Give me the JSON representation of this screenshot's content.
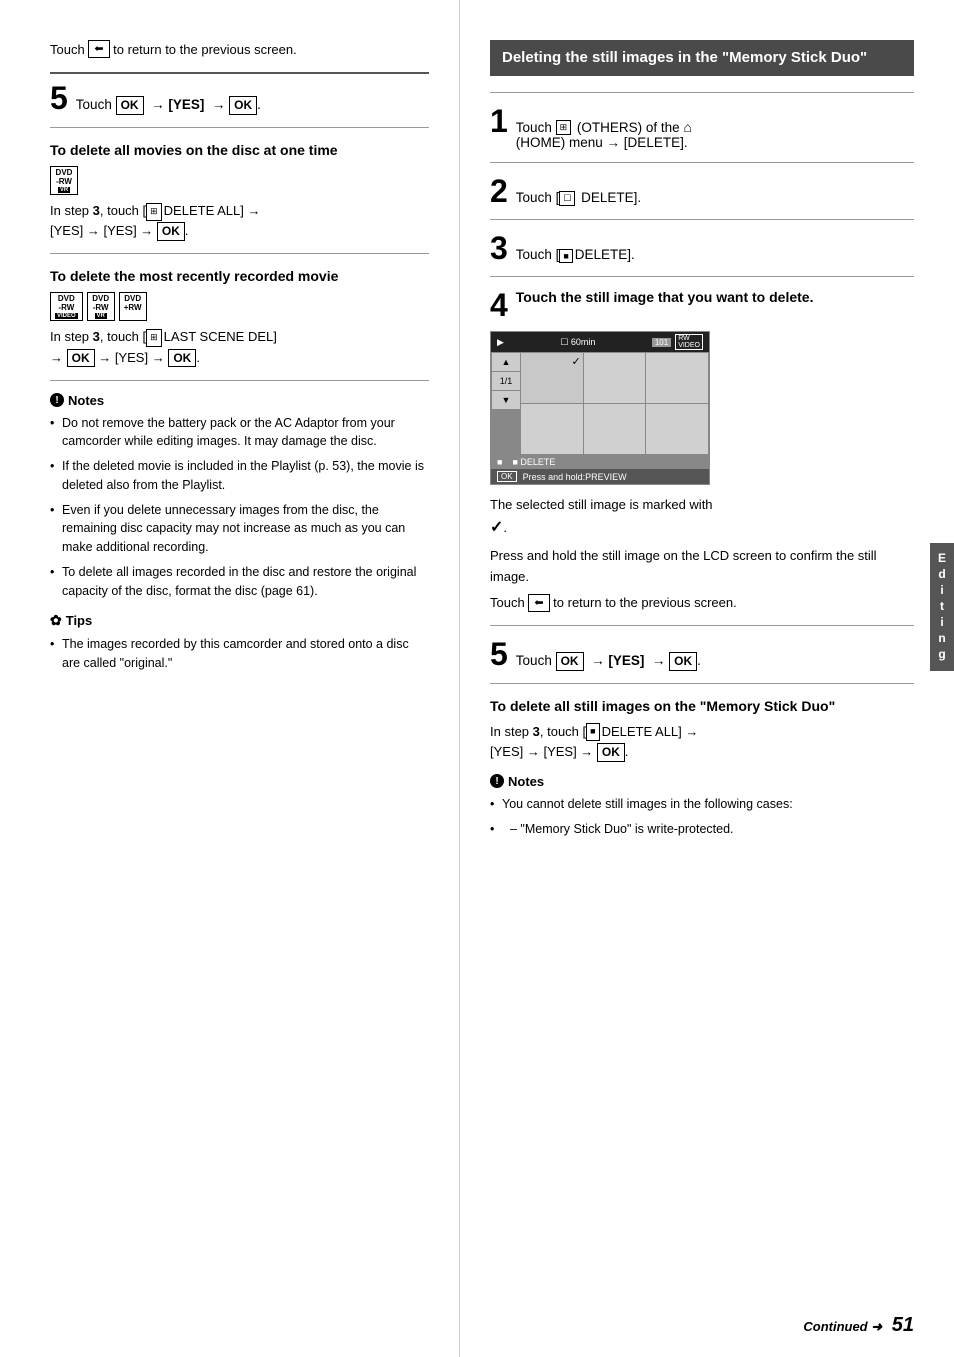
{
  "left": {
    "touch_back_text": "Touch",
    "touch_back_desc": "to return to the previous screen.",
    "step5_num": "5",
    "step5_text": "Touch",
    "step5_ok1": "OK",
    "step5_arrow1": "→",
    "step5_yes": "[YES]",
    "step5_arrow2": "→",
    "step5_ok2": "OK",
    "step5_period": ".",
    "section_delete_all_heading": "To delete all movies on the disc at one time",
    "dvd_rw_label": "DVD\n-RW",
    "dvd_vr_label": "VR",
    "delete_all_step": "In step 3, touch [",
    "delete_all_icon": "⊞",
    "delete_all_text": "DELETE ALL] →",
    "delete_all_yes1": "[YES] →",
    "delete_all_yes2": "[YES] →",
    "delete_all_ok": "OK",
    "delete_all_period": ".",
    "section_last_scene_heading": "To delete the most recently recorded movie",
    "dvd_rw_video_label": "DVD\n-RW",
    "dvd_video_badge": "VIDEO",
    "dvd_rw2_label": "DVD\n-RW",
    "dvd_vr2_badge": "VR",
    "dvd_plus_rw_label": "DVD\n+RW",
    "last_scene_step": "In step 3, touch  [",
    "last_scene_icon": "⊞",
    "last_scene_text": "LAST SCENE DEL]",
    "last_scene_arrow": "→",
    "last_scene_ok": "OK",
    "last_scene_arrow2": "→",
    "last_scene_yes": "[YES]",
    "last_scene_arrow3": "→",
    "last_scene_ok2": "OK",
    "last_scene_period": ".",
    "notes_title": "Notes",
    "notes": [
      "Do not remove the battery pack or the AC Adaptor from your camcorder while editing images. It may damage the disc.",
      "If the deleted movie is included in the Playlist (p. 53), the movie is deleted also from the Playlist.",
      "Even if you delete unnecessary images from the disc, the remaining disc capacity may not increase as much as you can make additional recording.",
      "To delete all images recorded in the disc and restore the original capacity of the disc, format the disc (page 61)."
    ],
    "tips_title": "Tips",
    "tips": [
      "The images recorded by this camcorder and stored onto a disc are called \"original.\""
    ]
  },
  "right": {
    "section_heading": "Deleting the still images in the \"Memory Stick Duo\"",
    "step1_num": "1",
    "step1_text": "Touch",
    "step1_others": "(OTHERS) of the",
    "step1_home": "(HOME) menu → [DELETE].",
    "step2_num": "2",
    "step2_text": "Touch [",
    "step2_icon": "☐",
    "step2_delete": " DELETE].",
    "step3_num": "3",
    "step3_text": "Touch [",
    "step3_icon": "■",
    "step3_delete": "DELETE].",
    "step4_num": "4",
    "step4_text": "Touch the still image that you want to delete.",
    "screen": {
      "top_left": "▶",
      "battery": "☐ 60min",
      "top_right_num": "101",
      "top_right_badge": "RW VIDEO",
      "nav_up": "▲",
      "page": "1/1",
      "nav_down": "▼",
      "delete_bar": "■ DELETE",
      "ok_label": "OK",
      "preview_label": "Press and hold:PREVIEW"
    },
    "selected_text_1": "The selected still image is marked with",
    "checkmark": "✓",
    "selected_text_2": ".",
    "press_hold_text": "Press and hold the still image on the LCD screen to confirm the still image.",
    "touch_return_text": "Touch",
    "touch_return_desc": "to return to the previous screen.",
    "step5_num": "5",
    "step5_text": "Touch",
    "step5_ok1": "OK",
    "step5_arrow1": "→",
    "step5_yes": "[YES]",
    "step5_arrow2": "→",
    "step5_ok2": "OK",
    "step5_period": ".",
    "delete_all_heading": "To delete all still images on the \"Memory Stick Duo\"",
    "delete_all_step_text": "In step 3, touch [",
    "delete_all_icon": "■",
    "delete_all_text": "DELETE ALL] →",
    "delete_all_yes1": "[YES] →",
    "delete_all_yes2": "[YES] →",
    "delete_all_ok": "OK",
    "delete_all_period": ".",
    "notes2_title": "Notes",
    "notes2": [
      "You cannot delete still images in the following cases:",
      "– \"Memory Stick Duo\" is write-protected."
    ],
    "continued_text": "Continued",
    "page_num": "51",
    "editing_tab": "Editing"
  }
}
